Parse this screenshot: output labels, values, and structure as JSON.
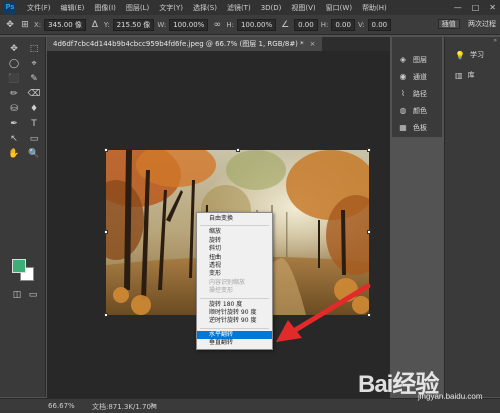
{
  "app": {
    "logo": "Ps"
  },
  "menubar": {
    "items": [
      "文件(F)",
      "编辑(E)",
      "图像(I)",
      "图层(L)",
      "文字(Y)",
      "选择(S)",
      "滤镜(T)",
      "3D(D)",
      "视图(V)",
      "窗口(W)",
      "帮助(H)"
    ],
    "window_controls": [
      "—",
      "□",
      "✕"
    ]
  },
  "options_bar": {
    "x_label": "X:",
    "x_value": "345.00 像",
    "y_label": "Y:",
    "y_value": "215.50 像",
    "w_label": "W:",
    "w_value": "100.00%",
    "h_label": "H:",
    "h_value": "100.00%",
    "angle_value": "0.00",
    "hskew_label": "H:",
    "hskew_value": "0.00",
    "vskew_label": "V:",
    "vskew_value": "0.00",
    "interpolation": "插值",
    "right_label": "两次过程"
  },
  "document_tab": {
    "title": "4d6df7cbc4d144b9b4cbcc959b4fd6fe.jpeg @ 66.7% (图层 1, RGB/8#) *",
    "close": "×"
  },
  "tools": [
    "✥",
    "⬚",
    "◯",
    "⌖",
    "⬛",
    "✎",
    "✏",
    "⌫",
    "⛁",
    "♦",
    "✒",
    "T",
    "↖",
    "▭",
    "✋",
    "🔍"
  ],
  "colors": {
    "foreground": "#3dae78",
    "background": "#ffffff",
    "highlight": "#0078d7",
    "arrow": "#e22a2a"
  },
  "context_menu": {
    "items": [
      {
        "label": "自由变换",
        "state": "normal"
      },
      {
        "sep": true
      },
      {
        "label": "缩放",
        "state": "normal"
      },
      {
        "label": "旋转",
        "state": "normal"
      },
      {
        "label": "斜切",
        "state": "normal"
      },
      {
        "label": "扭曲",
        "state": "normal"
      },
      {
        "label": "透视",
        "state": "normal"
      },
      {
        "label": "变形",
        "state": "normal"
      },
      {
        "label": "内容识别缩放",
        "state": "disabled"
      },
      {
        "label": "操控变形",
        "state": "disabled"
      },
      {
        "sep": true
      },
      {
        "label": "旋转 180 度",
        "state": "normal"
      },
      {
        "label": "顺时针旋转 90 度",
        "state": "normal"
      },
      {
        "label": "逆时针旋转 90 度",
        "state": "normal"
      },
      {
        "sep": true
      },
      {
        "label": "水平翻转",
        "state": "selected"
      },
      {
        "label": "垂直翻转",
        "state": "normal"
      }
    ]
  },
  "right_panel": {
    "items": [
      {
        "icon": "layers-icon",
        "glyph": "◈",
        "label": "图层"
      },
      {
        "icon": "channels-icon",
        "glyph": "◉",
        "label": "通道"
      },
      {
        "icon": "paths-icon",
        "glyph": "⌇",
        "label": "路径"
      },
      {
        "icon": "color-icon",
        "glyph": "◍",
        "label": "颜色"
      },
      {
        "icon": "swatches-icon",
        "glyph": "▦",
        "label": "色板"
      }
    ]
  },
  "right_panel2": {
    "items": [
      {
        "icon": "learn-icon",
        "glyph": "💡",
        "label": "学习"
      },
      {
        "icon": "library-icon",
        "glyph": "▥",
        "label": "库"
      }
    ]
  },
  "status_bar": {
    "zoom": "66.67%",
    "doc_info": "文档:871.3K/1.70M",
    "arrow": ">"
  },
  "watermark": {
    "text": "Bai经验",
    "sub": "jingyan.baidu.com"
  }
}
